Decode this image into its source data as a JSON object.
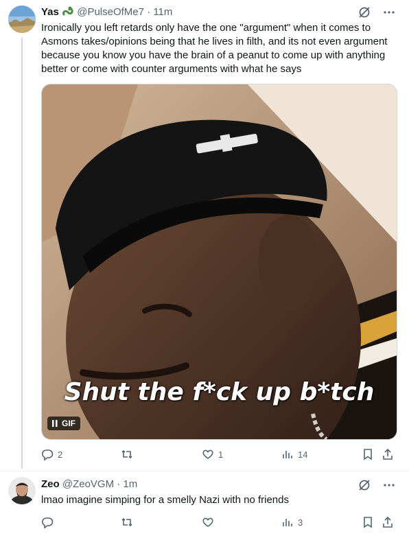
{
  "tweets": [
    {
      "display_name": "Yas",
      "handle": "@PulseOfMe7",
      "time": "· 11m",
      "text": "Ironically you left retards only have the one \"argument\" when it comes to Asmons takes/opinions being that he lives in filth, and its not even argument because you know you have the brain of a peanut to come up with anything better or come with counter arguments with what he says",
      "media": {
        "caption": "Shut the f*ck up b*tch",
        "badge": "GIF"
      },
      "stats": {
        "replies": "2",
        "retweets": "",
        "likes": "1",
        "views": "14"
      }
    },
    {
      "display_name": "Zeo",
      "handle": "@ZeoVGM",
      "time": "· 1m",
      "text": "lmao imagine simping for a smelly Nazi with no friends",
      "stats": {
        "replies": "",
        "retweets": "",
        "likes": "",
        "views": "3"
      }
    }
  ],
  "colors": {
    "muted": "#536471",
    "text": "#0f1419",
    "border": "#cfd9de",
    "accent_green": "#4a8f3c"
  }
}
